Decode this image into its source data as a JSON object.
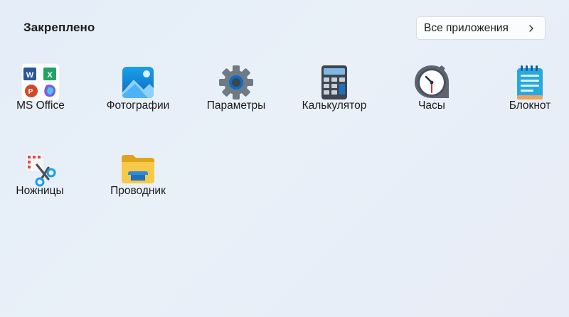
{
  "pinned": {
    "title": "Закреплено",
    "all_apps_label": "Все приложения",
    "apps": [
      {
        "label": "MS Office",
        "icon": "ms-office-icon"
      },
      {
        "label": "Фотографии",
        "icon": "photos-icon"
      },
      {
        "label": "Параметры",
        "icon": "settings-gear-icon"
      },
      {
        "label": "Калькулятор",
        "icon": "calculator-icon"
      },
      {
        "label": "Часы",
        "icon": "clock-icon"
      },
      {
        "label": "Блокнот",
        "icon": "notepad-icon"
      },
      {
        "label": "Ножницы",
        "icon": "snipping-tool-icon"
      },
      {
        "label": "Проводник",
        "icon": "file-explorer-folder-icon"
      }
    ]
  },
  "colors": {
    "word": "#2b579a",
    "excel": "#21a366",
    "powerpoint": "#d24726",
    "folder": "#f5c230",
    "accent": "#0f6cbd"
  }
}
